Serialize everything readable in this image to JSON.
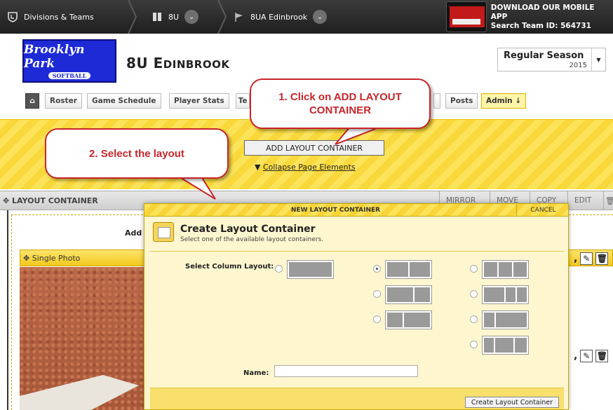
{
  "topbar": {
    "crumbs": [
      {
        "label": "Divisions & Teams",
        "icon": "shield-icon"
      },
      {
        "label": "8U",
        "icon": "book-icon"
      },
      {
        "label": "8UA Edinbrook",
        "icon": "pennant-icon"
      }
    ],
    "promo_line1": "DOWNLOAD OUR MOBILE APP",
    "promo_line2": "Search Team ID: 564731"
  },
  "header": {
    "logo_text": "Brooklyn Park",
    "logo_sub": "SOFTBALL",
    "team_prefix": "8U E",
    "team_rest": "DINBROOK",
    "season_label": "Regular Season",
    "season_year": "2015"
  },
  "nav": {
    "items": [
      "Roster",
      "Game Schedule",
      "Player Stats",
      "Te",
      "Posts",
      "Admin ↓"
    ]
  },
  "admin": {
    "add_layout_label": "ADD LAYOUT CONTAINER",
    "collapse_label": "Collapse Page Elements"
  },
  "layout_container": {
    "title": "LAYOUT CONTAINER",
    "actions": [
      "MIRROR",
      "MOVE",
      "COPY",
      "EDIT"
    ]
  },
  "content": {
    "add_text": "Add",
    "single_photo_label": "Single Photo"
  },
  "modal": {
    "title": "NEW LAYOUT CONTAINER",
    "cancel_label": "CANCEL",
    "heading": "Create Layout Container",
    "subheading": "Select one of the available layout containers.",
    "column_label": "Select Column Layout:",
    "name_label": "Name:",
    "name_value": "",
    "create_label": "Create Layout Container",
    "selected_layout": "two-equal"
  },
  "callouts": {
    "step1": "1. Click on ADD LAYOUT CONTAINER",
    "step2": "2. Select the layout",
    "color": "#c7262b"
  }
}
